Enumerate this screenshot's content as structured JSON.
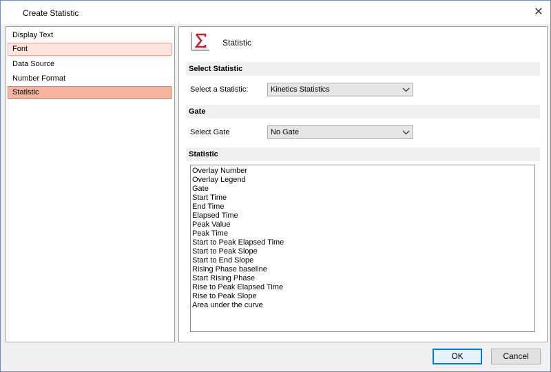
{
  "window": {
    "title": "Create Statistic",
    "close_glyph": "✕"
  },
  "nav": {
    "items": [
      {
        "label": "Display Text",
        "state": "normal"
      },
      {
        "label": "Font",
        "state": "highlight"
      },
      {
        "label": "Data Source",
        "state": "normal"
      },
      {
        "label": "Number Format",
        "state": "normal"
      },
      {
        "label": "Statistic",
        "state": "selected"
      }
    ]
  },
  "panel": {
    "header_title": "Statistic",
    "header_icon": "sigma-icon",
    "select_statistic": {
      "section": "Select Statistic",
      "label": "Select a Statistic:",
      "value": "Kinetics Statistics"
    },
    "gate": {
      "section": "Gate",
      "label": "Select Gate",
      "value": "No Gate"
    },
    "statistic": {
      "section": "Statistic",
      "items": [
        "Overlay Number",
        "Overlay Legend",
        "Gate",
        "Start Time",
        "End Time",
        "Elapsed Time",
        "Peak Value",
        "Peak Time",
        "Start to Peak Elapsed Time",
        "Start to Peak Slope",
        "Start to End Slope",
        "Rising Phase baseline",
        "Start Rising Phase",
        "Rise to Peak Elapsed Time",
        "Rise to Peak Slope",
        "Area under the curve"
      ]
    }
  },
  "footer": {
    "ok_label": "OK",
    "cancel_label": "Cancel"
  },
  "colors": {
    "accent": "#0078d7",
    "selected": "#f5b59f",
    "highlight": "#fde5df",
    "sigma": "#c8202f"
  }
}
